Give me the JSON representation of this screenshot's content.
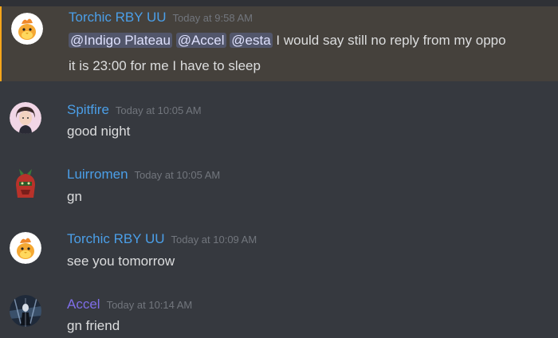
{
  "messages": [
    {
      "author": "Torchic RBY UU",
      "timestamp": "Today at 9:58 AM",
      "mentions": [
        "@Indigo Plateau",
        "@Accel",
        "@esta"
      ],
      "line1": "I would say still no reply from my oppo",
      "line2": "it is 23:00 for me I have to sleep",
      "avatar": "torchic-avatar"
    },
    {
      "author": "Spitfire",
      "timestamp": "Today at 10:05 AM",
      "text": "good night",
      "avatar": "anime-character-avatar"
    },
    {
      "author": "Luirromen",
      "timestamp": "Today at 10:05 AM",
      "text": "gn",
      "avatar": "red-creature-avatar"
    },
    {
      "author": "Torchic RBY UU",
      "timestamp": "Today at 10:09 AM",
      "text": "see you tomorrow",
      "avatar": "torchic-avatar"
    },
    {
      "author": "Accel",
      "timestamp": "Today at 10:14 AM",
      "text": "gn friend",
      "avatar": "dark-figure-avatar"
    }
  ],
  "colors": {
    "background": "#36393f",
    "username_blue": "#4b9fe8",
    "username_purple": "#7f6ee8",
    "timestamp": "#72767d",
    "text": "#dcddde",
    "mention_bg": "#4e5580",
    "highlight_border": "#faa61a"
  }
}
